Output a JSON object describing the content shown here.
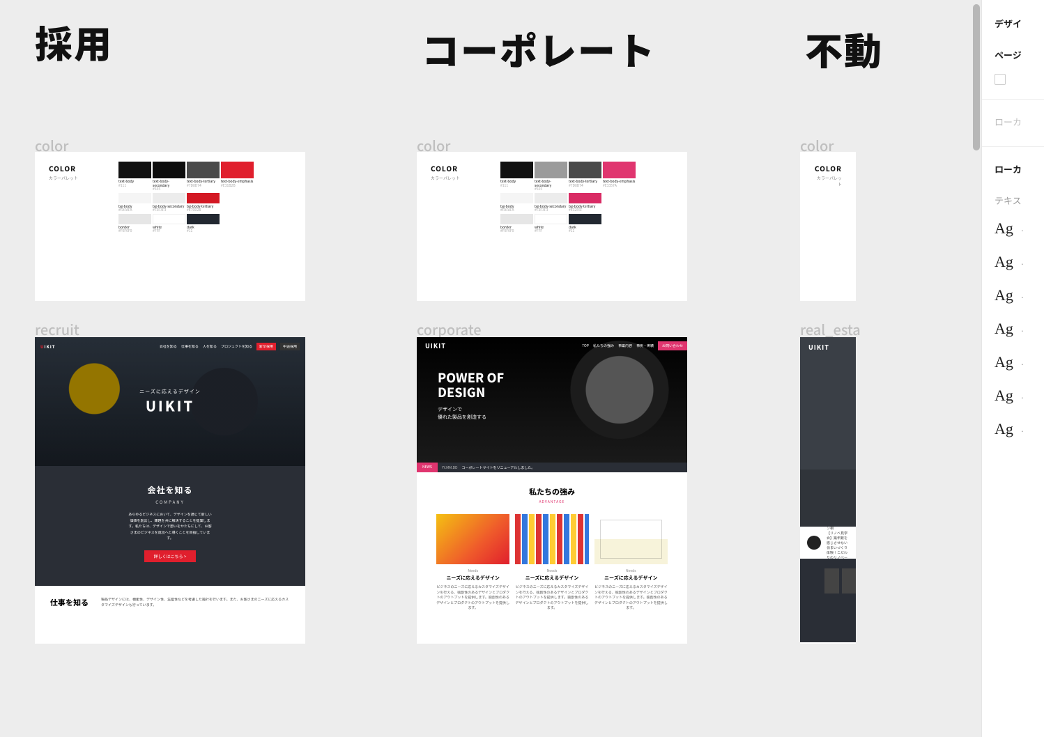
{
  "headings": {
    "recruit": "採用",
    "corporate": "コーポレート",
    "realestate": "不動"
  },
  "labels": {
    "color": "color",
    "recruit": "recruit",
    "corporate": "corporate",
    "realestate": "real_esta"
  },
  "palette": {
    "title": "COLOR",
    "subtitle": "カラーパレット",
    "swatches": {
      "text_body": {
        "label": "text-body",
        "hex": "#111"
      },
      "text_body_secondary": {
        "label": "text-body-secondary",
        "hex": "#555"
      },
      "text_body_tertiary": {
        "label": "text-body-tertiary",
        "hex": "#7D8D74"
      },
      "text_body_emphasis_r": {
        "label": "text-body-emphasis",
        "hex": "#E31B2B"
      },
      "text_body_emphasis_p": {
        "label": "text-body-emphasis",
        "hex": "#E3357A"
      },
      "bg_body": {
        "label": "bg-body",
        "hex": "#FAFAFA"
      },
      "bg_body_secondary": {
        "label": "bg-body-secondary",
        "hex": "#F3F3F3"
      },
      "bg_body_tertiary_r": {
        "label": "bg-body-tertiary",
        "hex": "#E70D28"
      },
      "bg_body_tertiary_p": {
        "label": "bg-body-tertiary",
        "hex": "#E32F6F"
      },
      "border": {
        "label": "border",
        "hex": "#F0F0F0"
      },
      "white": {
        "label": "white",
        "hex": "#FFF"
      },
      "dark": {
        "label": "dark",
        "hex": "#11"
      }
    }
  },
  "recruit": {
    "logo_pre": "U",
    "logo_rest": "IKIT",
    "nav": [
      "会社を知る",
      "仕事を知る",
      "人を知る",
      "プロジェクトを知る"
    ],
    "nav_btn_red": "新卒採用",
    "nav_btn_gray": "中途採用",
    "hero_tag": "ニーズに応えるデザイン",
    "hero_title": "UIKIT",
    "company_title": "会社を知る",
    "company_en": "COMPANY",
    "company_body": "あらゆるビジネスにおいて、デザインを通じて新しい価値を創出し、課題を共に解決することを提案します。私たちは、デザインで想いをかたちにして、お客さまのビジネスを成功へと導くことを目指しています。",
    "company_cta": "詳しくはこちら   >",
    "work_title": "仕事を知る",
    "work_body": "製品デザインには、機能性、デザイン性、生産性などを考慮した設計を行います。また、お客さまのニーズに応えるカスタマイズデザインも行っています。"
  },
  "corporate": {
    "logo": "UIKIT",
    "nav": [
      "TOP",
      "私たちの強み",
      "事業内容",
      "事例・実績"
    ],
    "nav_cta": "お問い合わせ",
    "hero_title_1": "POWER OF",
    "hero_title_2": "DESIGN",
    "hero_sub_1": "デザインで",
    "hero_sub_2": "優れた製品を創造する",
    "news_tag": "NEWS",
    "news_date": "YY.MM.DD",
    "news_msg": "コーポレートサイトをリニューアルしました。",
    "adv_title": "私たちの強み",
    "adv_en": "ADVANTAGE",
    "card_mini": "Needs",
    "card_title": "ニーズに応えるデザイン",
    "card_body": "ビジネスのニーズに応えるカスタマイズデザインを行える、独創性のあるデザインとプロダクトのアウトプットを提供します。独創性のあるデザインとプロダクトのアウトプットを提供します。"
  },
  "realestate": {
    "logo": "UIKIT",
    "strip_tag": "今週  オンライン相",
    "strip_body": "【リノベ見学会】築年数を感じさせない住まいづくり体験！こだわりのリノベーショ"
  },
  "panel": {
    "design": "デザイ",
    "page": "ページ",
    "local_gray": "ローカ",
    "local_black": "ローカ",
    "text": "テキス",
    "ag": "Ag"
  }
}
